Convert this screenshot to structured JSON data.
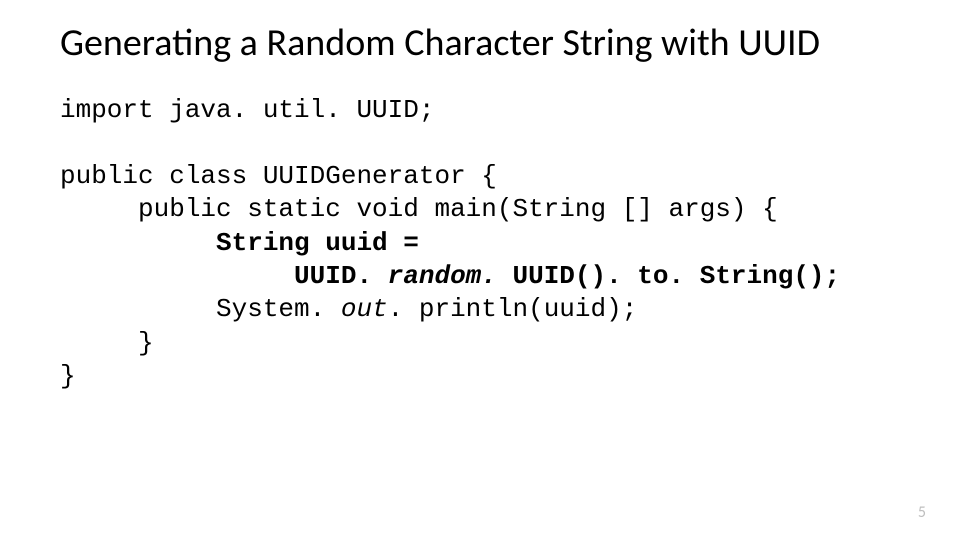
{
  "title": "Generating a Random Character String with UUID",
  "code": {
    "l1": "import java. util. UUID;",
    "l2": "",
    "l3": "public class UUIDGenerator {",
    "l4": "     public static void main(String [] args) {",
    "l5a": "          String uuid =",
    "l5b": "               UUID. ",
    "l5c": "random. ",
    "l5d": "UUID(). to. String();",
    "l6a": "          System. ",
    "l6b": "out",
    "l6c": ". println(uuid);",
    "l7": "     }",
    "l8": "}"
  },
  "page_number": "5"
}
